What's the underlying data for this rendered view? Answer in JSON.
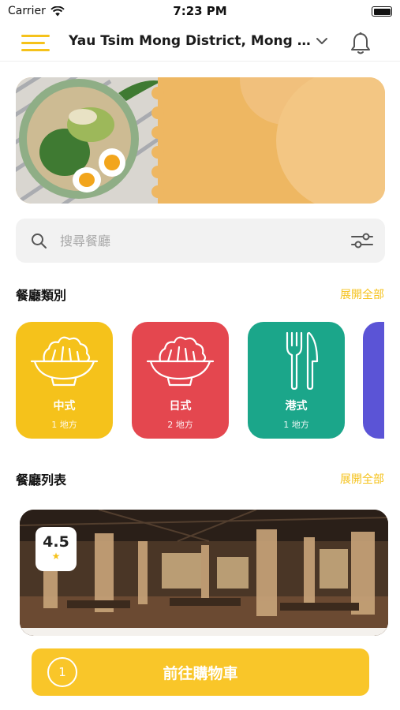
{
  "status_bar": {
    "carrier": "Carrier",
    "time": "7:23 PM"
  },
  "header": {
    "location": "Yau Tsim Mong District, Mong Kok, Hong Kong",
    "menu_icon": "hamburger-menu-icon",
    "dropdown_icon": "chevron-down-icon",
    "notification_icon": "bell-icon"
  },
  "banner": {
    "image": "food-bowl-photo"
  },
  "search": {
    "placeholder": "搜尋餐廳",
    "value": ""
  },
  "categories_section": {
    "title": "餐廳類別",
    "see_all": "展開全部",
    "items": [
      {
        "name": "中式",
        "count": "1 地方",
        "color": "#F5C21B",
        "icon": "salad-bowl-icon"
      },
      {
        "name": "日式",
        "count": "2 地方",
        "color": "#E4474F",
        "icon": "salad-bowl-icon"
      },
      {
        "name": "港式",
        "count": "1 地方",
        "color": "#1BA68A",
        "icon": "fork-knife-icon"
      },
      {
        "color": "#5B54D6"
      }
    ]
  },
  "restaurants_section": {
    "title": "餐廳列表",
    "see_all": "展開全部",
    "items": [
      {
        "rating": "4.5",
        "image": "restaurant-interior-photo"
      }
    ]
  },
  "cart": {
    "count": "1",
    "label": "前往購物車"
  },
  "colors": {
    "accent": "#F5C21B",
    "cart_button": "#F9C629"
  }
}
